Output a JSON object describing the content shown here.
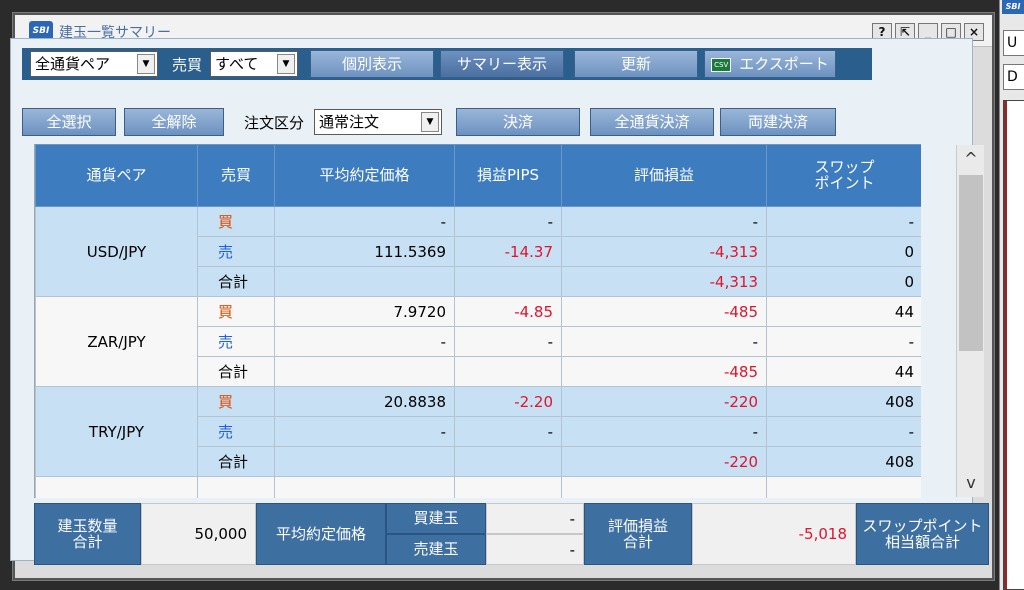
{
  "window": {
    "logo": "SBI",
    "title": "建玉一覧サマリー",
    "controls": {
      "help": "?",
      "popout": "⇱",
      "minimize": "_",
      "maximize": "□",
      "close": "×"
    }
  },
  "toolbar1": {
    "pair_filter": "全通貨ペア",
    "side_label": "売買",
    "side_filter": "すべて",
    "individual_view": "個別表示",
    "summary_view": "サマリー表示",
    "refresh": "更新",
    "export": "エクスポート",
    "export_icon_text": "CSV"
  },
  "toolbar2": {
    "select_all": "全選択",
    "deselect_all": "全解除",
    "order_type_label": "注文区分",
    "order_type": "通常注文",
    "settle": "決済",
    "settle_all": "全通貨決済",
    "settle_both": "両建決済"
  },
  "table": {
    "headers": {
      "pair": "通貨ペア",
      "side": "売買",
      "avg_price": "平均約定価格",
      "pips": "損益PIPS",
      "pnl": "評価損益",
      "swap_l1": "スワップ",
      "swap_l2": "ポイント"
    },
    "groups": [
      {
        "pair": "USD/JPY",
        "rows": [
          {
            "side": "買",
            "price": "-",
            "pips": "-",
            "pnl": "-",
            "swap": "-"
          },
          {
            "side": "売",
            "price": "111.5369",
            "pips": "-14.37",
            "pnl": "-4,313",
            "swap": "0"
          },
          {
            "side": "合計",
            "price": "",
            "pips": "",
            "pnl": "-4,313",
            "swap": "0"
          }
        ]
      },
      {
        "pair": "ZAR/JPY",
        "rows": [
          {
            "side": "買",
            "price": "7.9720",
            "pips": "-4.85",
            "pnl": "-485",
            "swap": "44"
          },
          {
            "side": "売",
            "price": "-",
            "pips": "-",
            "pnl": "-",
            "swap": "-"
          },
          {
            "side": "合計",
            "price": "",
            "pips": "",
            "pnl": "-485",
            "swap": "44"
          }
        ]
      },
      {
        "pair": "TRY/JPY",
        "rows": [
          {
            "side": "買",
            "price": "20.8838",
            "pips": "-2.20",
            "pnl": "-220",
            "swap": "408"
          },
          {
            "side": "売",
            "price": "-",
            "pips": "-",
            "pnl": "-",
            "swap": "-"
          },
          {
            "side": "合計",
            "price": "",
            "pips": "",
            "pnl": "-220",
            "swap": "408"
          }
        ]
      }
    ]
  },
  "scrollbar": {
    "up": "^",
    "down": "v"
  },
  "summary": {
    "qty_l1": "建玉数量",
    "qty_l2": "合計",
    "qty_value": "50,000",
    "avg_price_label": "平均約定価格",
    "buy_label": "買建玉",
    "buy_value": "-",
    "sell_label": "売建玉",
    "sell_value": "-",
    "pnl_l1": "評価損益",
    "pnl_l2": "合計",
    "pnl_value": "-5,018",
    "swap_l1": "スワップポイント",
    "swap_l2": "相当額合計"
  },
  "side_panel": {
    "logo": "SBI",
    "box1": "U",
    "box2": "D"
  },
  "colors": {
    "header_blue": "#3d7cbf",
    "toolbar_navy": "#2a5e8c",
    "buy": "#e04a00",
    "sell": "#1e5ee8",
    "negative": "#e0142b"
  }
}
